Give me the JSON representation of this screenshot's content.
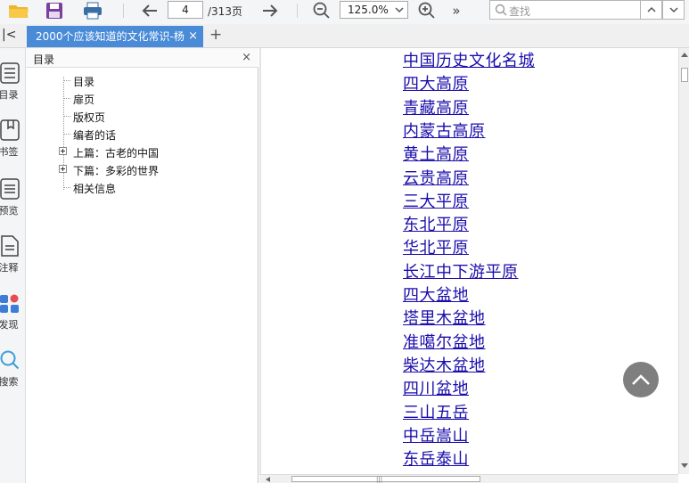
{
  "toolbar": {
    "page_current": "4",
    "page_total": "/313页",
    "zoom": "125.0%",
    "search_placeholder": "查找",
    "more": "»"
  },
  "tabs": {
    "collapse": "|<",
    "doc_title": "2000个应该知道的文化常识-杨",
    "close": "×",
    "add": "+"
  },
  "rail": {
    "items": [
      {
        "label": "目录",
        "icon": "list-icon"
      },
      {
        "label": "书签",
        "icon": "bookmark-icon"
      },
      {
        "label": "预览",
        "icon": "preview-icon"
      },
      {
        "label": "注释",
        "icon": "annotation-icon"
      },
      {
        "label": "发现",
        "icon": "discover-icon"
      },
      {
        "label": "搜索",
        "icon": "search-icon"
      }
    ]
  },
  "outline": {
    "title": "目录",
    "close": "×",
    "items": [
      {
        "label": "目录",
        "expandable": false
      },
      {
        "label": "扉页",
        "expandable": false
      },
      {
        "label": "版权页",
        "expandable": false
      },
      {
        "label": "编者的话",
        "expandable": false
      },
      {
        "label": "上篇：古老的中国",
        "expandable": true
      },
      {
        "label": "下篇：多彩的世界",
        "expandable": true
      },
      {
        "label": "相关信息",
        "expandable": false
      }
    ]
  },
  "content": {
    "links": [
      "中国历史文化名城",
      "四大高原",
      "青藏高原",
      "内蒙古高原",
      "黄土高原",
      "云贵高原",
      "三大平原",
      "东北平原",
      "华北平原",
      "长江中下游平原",
      "四大盆地",
      "塔里木盆地",
      "准噶尔盆地",
      "柴达木盆地",
      "四川盆地",
      "三山五岳",
      "中岳嵩山",
      "东岳泰山"
    ]
  },
  "colors": {
    "accent": "#4a8bd8",
    "link": "#1a0dab"
  }
}
